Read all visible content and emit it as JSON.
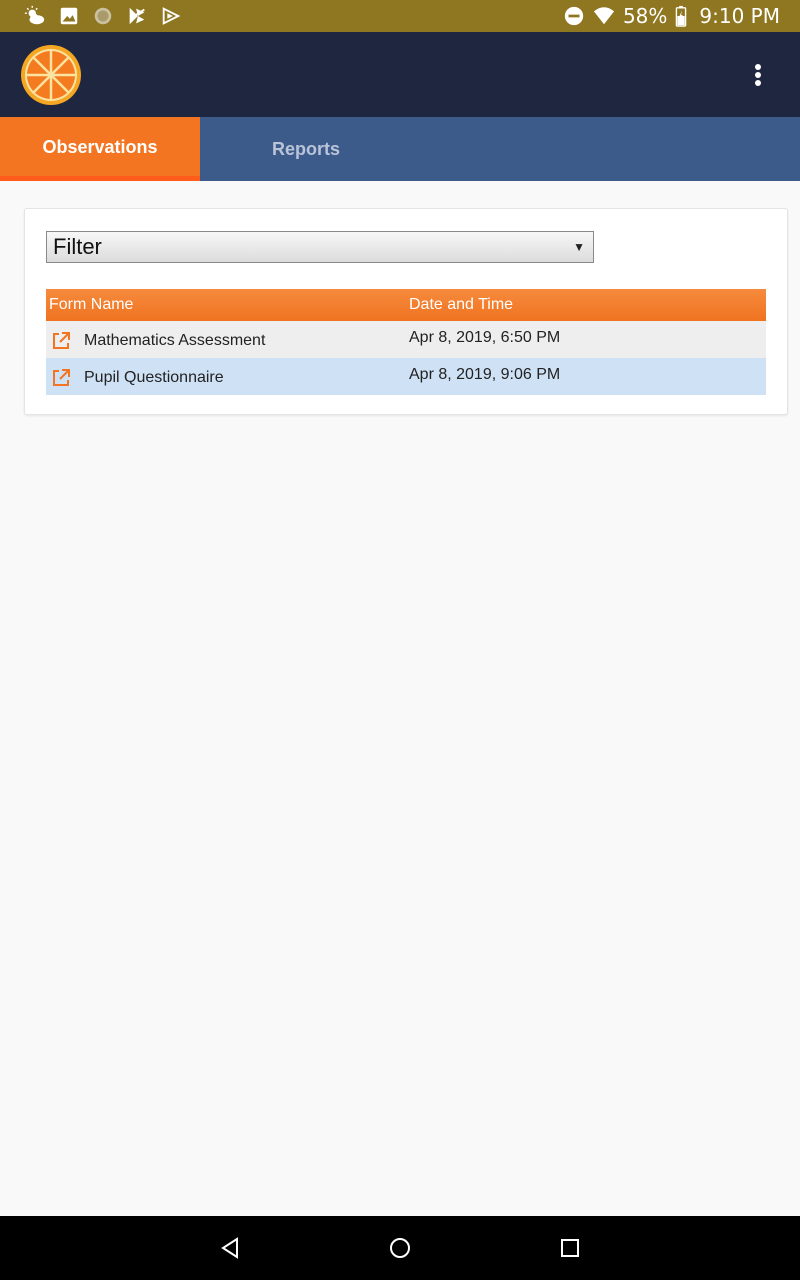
{
  "status_bar": {
    "battery_percent": "58%",
    "time": "9:10 PM",
    "icons_left": [
      "weather-icon",
      "image-icon",
      "circle-app-icon",
      "play-store-icon",
      "play-movies-icon"
    ],
    "icons_right": [
      "do-not-disturb-icon",
      "wifi-icon",
      "battery-icon"
    ],
    "background_color": "#8f7620"
  },
  "app_bar": {
    "logo": "orange-slice-logo",
    "menu_icon": "more-vert-icon",
    "background_color": "#1f2740"
  },
  "tabs": [
    {
      "label": "Observations",
      "active": true
    },
    {
      "label": "Reports",
      "active": false
    }
  ],
  "filter": {
    "label": "Filter"
  },
  "table": {
    "columns": [
      "Form Name",
      "Date and Time"
    ],
    "rows": [
      {
        "name": "Mathematics Assessment",
        "date": "Apr 8, 2019, 6:50 PM",
        "icon": "open-in-new-icon"
      },
      {
        "name": "Pupil Questionnaire",
        "date": "Apr 8, 2019, 9:06 PM",
        "icon": "open-in-new-icon"
      }
    ]
  },
  "nav_bar": {
    "buttons": [
      "back-icon",
      "home-icon",
      "recents-icon"
    ]
  },
  "colors": {
    "accent_orange": "#f37521",
    "tab_bar_blue": "#3c5a8a",
    "row_highlight": "#cfe2f5"
  }
}
